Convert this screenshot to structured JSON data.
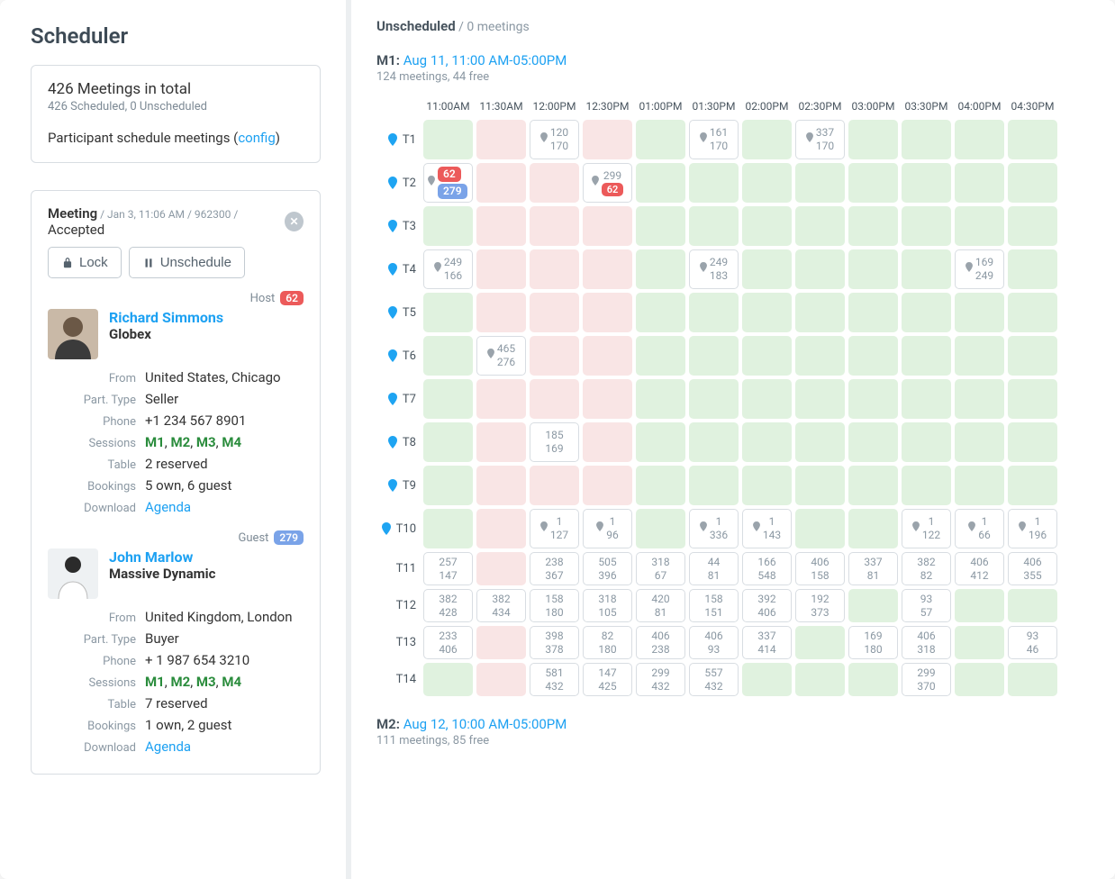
{
  "left": {
    "title": "Scheduler",
    "summary": {
      "line1": "426 Meetings in total",
      "line2": "426 Scheduled, 0 Unscheduled",
      "line3_pre": "Participant schedule meetings (",
      "config_link": "config",
      "line3_post": ")"
    },
    "meeting": {
      "title_prefix": "Meeting",
      "sub": " / Jan 3, 11:06 AM / 962300 / ",
      "state": "Accepted",
      "lock_btn": "Lock",
      "unschedule_btn": "Unschedule",
      "host_label": "Host",
      "host_badge": "62",
      "host": {
        "name": "Richard Simmons",
        "company": "Globex",
        "from_lbl": "From",
        "from": "United States, Chicago",
        "ptype_lbl": "Part. Type",
        "ptype": "Seller",
        "phone_lbl": "Phone",
        "phone": "+1 234 567 8901",
        "sessions_lbl": "Sessions",
        "sessions": [
          "M1",
          "M2",
          "M3",
          "M4"
        ],
        "table_lbl": "Table",
        "table": "2 reserved",
        "bookings_lbl": "Bookings",
        "bookings": "5 own, 6 guest",
        "download_lbl": "Download",
        "agenda": "Agenda"
      },
      "guest_label": "Guest",
      "guest_badge": "279",
      "guest": {
        "name": "John Marlow",
        "company": "Massive Dynamic",
        "from_lbl": "From",
        "from": "United Kingdom, London",
        "ptype_lbl": "Part. Type",
        "ptype": "Buyer",
        "phone_lbl": "Phone",
        "phone": "+ 1 987 654 3210",
        "sessions_lbl": "Sessions",
        "sessions": [
          "M1",
          "M2",
          "M3",
          "M4"
        ],
        "table_lbl": "Table",
        "table": "7 reserved",
        "bookings_lbl": "Bookings",
        "bookings": "1 own, 2 guest",
        "download_lbl": "Download",
        "agenda": "Agenda"
      }
    }
  },
  "right": {
    "unscheduled": {
      "title": "Unscheduled",
      "sub": " / 0 meetings"
    },
    "sessions": [
      {
        "id": "M1",
        "range": "Aug 11, 11:00 AM-05:00PM",
        "summary": "124 meetings, 44 free",
        "times": [
          "11:00AM",
          "11:30AM",
          "12:00PM",
          "12:30PM",
          "01:00PM",
          "01:30PM",
          "02:00PM",
          "02:30PM",
          "03:00PM",
          "03:30PM",
          "04:00PM",
          "04:30PM"
        ],
        "rows": [
          {
            "label": "T1",
            "marker": true,
            "tall": true,
            "cells": [
              {
                "t": "green"
              },
              {
                "t": "pink"
              },
              {
                "t": "white",
                "pin": true,
                "a": "120",
                "b": "170"
              },
              {
                "t": "pink"
              },
              {
                "t": "green"
              },
              {
                "t": "white",
                "pin": true,
                "a": "161",
                "b": "170"
              },
              {
                "t": "green"
              },
              {
                "t": "white",
                "pin": true,
                "a": "337",
                "b": "170"
              },
              {
                "t": "green"
              },
              {
                "t": "green"
              },
              {
                "t": "green"
              },
              {
                "t": "green"
              }
            ]
          },
          {
            "label": "T2",
            "marker": true,
            "tall": true,
            "cells": [
              {
                "t": "white",
                "badge": true,
                "pin": true,
                "red": "62",
                "blue": "279"
              },
              {
                "t": "pink"
              },
              {
                "t": "pink"
              },
              {
                "t": "white",
                "pin": true,
                "a": "299",
                "redbadge": "62"
              },
              {
                "t": "green"
              },
              {
                "t": "green"
              },
              {
                "t": "green"
              },
              {
                "t": "green"
              },
              {
                "t": "green"
              },
              {
                "t": "green"
              },
              {
                "t": "green"
              },
              {
                "t": "green"
              }
            ]
          },
          {
            "label": "T3",
            "marker": true,
            "tall": true,
            "cells": [
              {
                "t": "green"
              },
              {
                "t": "pink"
              },
              {
                "t": "pink"
              },
              {
                "t": "pink"
              },
              {
                "t": "green"
              },
              {
                "t": "green"
              },
              {
                "t": "green"
              },
              {
                "t": "green"
              },
              {
                "t": "green"
              },
              {
                "t": "green"
              },
              {
                "t": "green"
              },
              {
                "t": "green"
              }
            ]
          },
          {
            "label": "T4",
            "marker": true,
            "tall": true,
            "cells": [
              {
                "t": "white",
                "pin": true,
                "a": "249",
                "b": "166"
              },
              {
                "t": "pink"
              },
              {
                "t": "pink"
              },
              {
                "t": "pink"
              },
              {
                "t": "green"
              },
              {
                "t": "white",
                "pin": true,
                "a": "249",
                "b": "183"
              },
              {
                "t": "green"
              },
              {
                "t": "green"
              },
              {
                "t": "green"
              },
              {
                "t": "green"
              },
              {
                "t": "white",
                "pin": true,
                "a": "169",
                "b": "249"
              },
              {
                "t": "green"
              }
            ]
          },
          {
            "label": "T5",
            "marker": true,
            "tall": true,
            "cells": [
              {
                "t": "green"
              },
              {
                "t": "pink"
              },
              {
                "t": "pink"
              },
              {
                "t": "pink"
              },
              {
                "t": "green"
              },
              {
                "t": "green"
              },
              {
                "t": "green"
              },
              {
                "t": "green"
              },
              {
                "t": "green"
              },
              {
                "t": "green"
              },
              {
                "t": "green"
              },
              {
                "t": "green"
              }
            ]
          },
          {
            "label": "T6",
            "marker": true,
            "tall": true,
            "cells": [
              {
                "t": "green"
              },
              {
                "t": "white",
                "pin": true,
                "a": "465",
                "b": "276"
              },
              {
                "t": "pink"
              },
              {
                "t": "pink"
              },
              {
                "t": "green"
              },
              {
                "t": "green"
              },
              {
                "t": "green"
              },
              {
                "t": "green"
              },
              {
                "t": "green"
              },
              {
                "t": "green"
              },
              {
                "t": "green"
              },
              {
                "t": "green"
              }
            ]
          },
          {
            "label": "T7",
            "marker": true,
            "tall": true,
            "cells": [
              {
                "t": "green"
              },
              {
                "t": "pink"
              },
              {
                "t": "pink"
              },
              {
                "t": "pink"
              },
              {
                "t": "green"
              },
              {
                "t": "green"
              },
              {
                "t": "green"
              },
              {
                "t": "green"
              },
              {
                "t": "green"
              },
              {
                "t": "green"
              },
              {
                "t": "green"
              },
              {
                "t": "green"
              }
            ]
          },
          {
            "label": "T8",
            "marker": true,
            "tall": true,
            "cells": [
              {
                "t": "green"
              },
              {
                "t": "pink"
              },
              {
                "t": "white",
                "a": "185",
                "b": "169"
              },
              {
                "t": "pink"
              },
              {
                "t": "green"
              },
              {
                "t": "green"
              },
              {
                "t": "green"
              },
              {
                "t": "green"
              },
              {
                "t": "green"
              },
              {
                "t": "green"
              },
              {
                "t": "green"
              },
              {
                "t": "green"
              }
            ]
          },
          {
            "label": "T9",
            "marker": true,
            "tall": true,
            "cells": [
              {
                "t": "green"
              },
              {
                "t": "pink"
              },
              {
                "t": "pink"
              },
              {
                "t": "pink"
              },
              {
                "t": "green"
              },
              {
                "t": "green"
              },
              {
                "t": "green"
              },
              {
                "t": "green"
              },
              {
                "t": "green"
              },
              {
                "t": "green"
              },
              {
                "t": "green"
              },
              {
                "t": "green"
              }
            ]
          },
          {
            "label": "T10",
            "marker": true,
            "tall": true,
            "cells": [
              {
                "t": "green"
              },
              {
                "t": "pink"
              },
              {
                "t": "white",
                "pin": true,
                "a": "1",
                "b": "127"
              },
              {
                "t": "white",
                "pin": true,
                "a": "1",
                "b": "96"
              },
              {
                "t": "green"
              },
              {
                "t": "white",
                "pin": true,
                "a": "1",
                "b": "336"
              },
              {
                "t": "white",
                "pin": true,
                "a": "1",
                "b": "143"
              },
              {
                "t": "green"
              },
              {
                "t": "green"
              },
              {
                "t": "white",
                "pin": true,
                "a": "1",
                "b": "122"
              },
              {
                "t": "white",
                "pin": true,
                "a": "1",
                "b": "66"
              },
              {
                "t": "white",
                "pin": true,
                "a": "1",
                "b": "196"
              }
            ]
          },
          {
            "label": "T11",
            "marker": false,
            "tall": false,
            "cells": [
              {
                "t": "white",
                "a": "257",
                "b": "147"
              },
              {
                "t": "pink"
              },
              {
                "t": "white",
                "a": "238",
                "b": "367"
              },
              {
                "t": "white",
                "a": "505",
                "b": "396"
              },
              {
                "t": "white",
                "a": "318",
                "b": "67"
              },
              {
                "t": "white",
                "a": "44",
                "b": "81"
              },
              {
                "t": "white",
                "a": "166",
                "b": "548"
              },
              {
                "t": "white",
                "a": "406",
                "b": "158"
              },
              {
                "t": "white",
                "a": "337",
                "b": "81"
              },
              {
                "t": "white",
                "a": "382",
                "b": "82"
              },
              {
                "t": "white",
                "a": "406",
                "b": "412"
              },
              {
                "t": "white",
                "a": "406",
                "b": "355"
              }
            ]
          },
          {
            "label": "T12",
            "marker": false,
            "tall": false,
            "cells": [
              {
                "t": "white",
                "a": "382",
                "b": "428"
              },
              {
                "t": "white",
                "a": "382",
                "b": "434"
              },
              {
                "t": "white",
                "a": "158",
                "b": "180"
              },
              {
                "t": "white",
                "a": "318",
                "b": "105"
              },
              {
                "t": "white",
                "a": "420",
                "b": "81"
              },
              {
                "t": "white",
                "a": "158",
                "b": "151"
              },
              {
                "t": "white",
                "a": "392",
                "b": "406"
              },
              {
                "t": "white",
                "a": "192",
                "b": "373"
              },
              {
                "t": "green"
              },
              {
                "t": "white",
                "a": "93",
                "b": "57"
              },
              {
                "t": "green"
              },
              {
                "t": "green"
              }
            ]
          },
          {
            "label": "T13",
            "marker": false,
            "tall": false,
            "cells": [
              {
                "t": "white",
                "a": "233",
                "b": "406"
              },
              {
                "t": "pink"
              },
              {
                "t": "white",
                "a": "398",
                "b": "378"
              },
              {
                "t": "white",
                "a": "82",
                "b": "180"
              },
              {
                "t": "white",
                "a": "406",
                "b": "238"
              },
              {
                "t": "white",
                "a": "406",
                "b": "93"
              },
              {
                "t": "white",
                "a": "337",
                "b": "414"
              },
              {
                "t": "green"
              },
              {
                "t": "white",
                "a": "169",
                "b": "180"
              },
              {
                "t": "white",
                "a": "406",
                "b": "318"
              },
              {
                "t": "green"
              },
              {
                "t": "white",
                "a": "93",
                "b": "46"
              }
            ]
          },
          {
            "label": "T14",
            "marker": false,
            "tall": false,
            "cells": [
              {
                "t": "green"
              },
              {
                "t": "pink"
              },
              {
                "t": "white",
                "a": "581",
                "b": "432"
              },
              {
                "t": "white",
                "a": "147",
                "b": "425"
              },
              {
                "t": "white",
                "a": "299",
                "b": "432"
              },
              {
                "t": "white",
                "a": "557",
                "b": "432"
              },
              {
                "t": "green"
              },
              {
                "t": "green"
              },
              {
                "t": "green"
              },
              {
                "t": "white",
                "a": "299",
                "b": "370"
              },
              {
                "t": "green"
              },
              {
                "t": "green"
              }
            ]
          }
        ]
      },
      {
        "id": "M2",
        "range": "Aug 12, 10:00 AM-05:00PM",
        "summary": "111 meetings, 85 free"
      }
    ]
  }
}
